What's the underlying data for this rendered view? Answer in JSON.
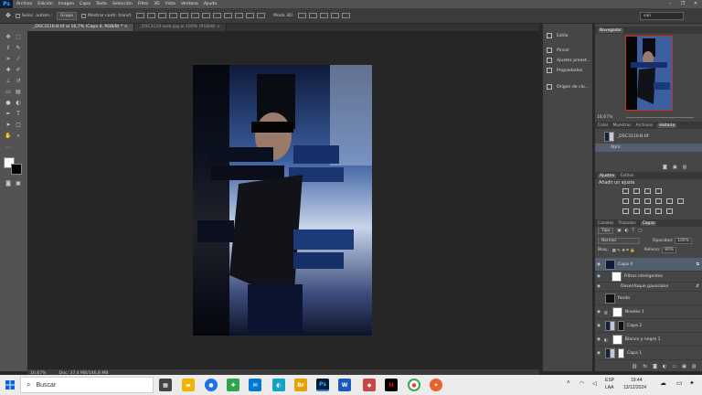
{
  "app": {
    "logo": "Ps"
  },
  "menu": [
    "Archivo",
    "Edición",
    "Imagen",
    "Capa",
    "Texto",
    "Selección",
    "Filtro",
    "3D",
    "Vista",
    "Ventana",
    "Ayuda"
  ],
  "window_controls": [
    "–",
    "❐",
    "✕"
  ],
  "options_bar": {
    "auto_select_label": "Selec. autom.:",
    "auto_select_value": "Grupo",
    "transform_label": "Mostrar contr. transf.",
    "mode_3d_label": "Modo 3D:",
    "workspace": "sali"
  },
  "tabs": [
    {
      "label": "_DSC3110-B.tif al 16,7% (Capa 4, RGB/8) *",
      "close": "×"
    },
    {
      "label": "_DSC3110-web.jpg al 100% (RGB/8)",
      "close": "×"
    }
  ],
  "status": {
    "zoom": "16,67%",
    "doc": "Doc: 37,4 MB/146,8 MB"
  },
  "mid_panel": {
    "items": [
      {
        "label": "Estilo",
        "icon": "style-icon"
      },
      {
        "label": "Pincel",
        "icon": "brush-icon"
      },
      {
        "label": "Ajustes preest...",
        "icon": "presets-icon"
      },
      {
        "label": "Propiedades",
        "icon": "properties-icon"
      },
      {
        "label": "Origen de clo...",
        "icon": "clone-source-icon"
      }
    ]
  },
  "navigator": {
    "title": "Navegador",
    "zoom": "16,67%"
  },
  "history_tabs": [
    "Color",
    "Muestras",
    "Archivos",
    "Historia"
  ],
  "history": {
    "snapshot": "_DSC3110-B.tif",
    "step": "Abrir"
  },
  "adjust_tabs": [
    "Ajustes",
    "Estilos"
  ],
  "adjust_title": "Añadir un ajuste",
  "layers_tabs": [
    "Canales",
    "Trazados",
    "Capas"
  ],
  "layers": {
    "filter_kind": "Tipo",
    "blend_mode": "Normal",
    "opacity_label": "Opacidad:",
    "opacity": "100%",
    "lock_label": "Bloq.:",
    "fill_label": "Relleno:",
    "fill": "80%",
    "rows": [
      {
        "name": "Capa 4",
        "thumb": "dark",
        "selected": true,
        "indent": 0
      },
      {
        "name": "Filtros inteligentes",
        "thumb": "white",
        "selected": false,
        "indent": 1
      },
      {
        "name": "Desenfoque gaussiano",
        "thumb": "none",
        "selected": false,
        "indent": 2
      },
      {
        "name": "fondo",
        "thumb": "dark",
        "selected": false,
        "indent": 0
      },
      {
        "name": "Niveles 1",
        "thumb": "white",
        "selected": false,
        "indent": 0
      },
      {
        "name": "Capa 2",
        "thumb": "mixed",
        "selected": false,
        "indent": 0
      },
      {
        "name": "Blanco y negro 1",
        "thumb": "white",
        "selected": false,
        "indent": 0
      },
      {
        "name": "Capa 1",
        "thumb": "mixed",
        "selected": false,
        "indent": 0
      }
    ]
  },
  "taskbar": {
    "search_placeholder": "Buscar",
    "lang": "ESP",
    "lang2": "LAA",
    "time": "19:44",
    "date": "13/12/2024"
  },
  "colors": {
    "accent": "#31a8ff",
    "menubar": "#535353",
    "canvas_bg": "#262626",
    "panel": "#464646"
  }
}
